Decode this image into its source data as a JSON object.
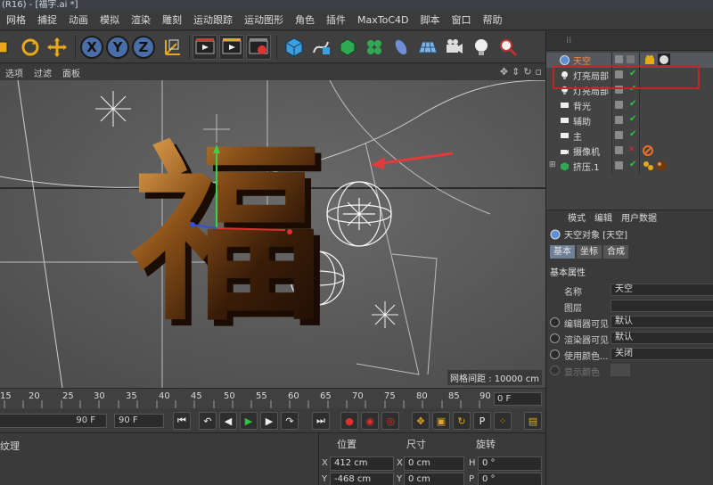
{
  "window": {
    "title": "(R16) - [福字.ai *]"
  },
  "menubar": [
    "网格",
    "捕捉",
    "动画",
    "模拟",
    "渲染",
    "雕刻",
    "运动跟踪",
    "运动图形",
    "角色",
    "插件",
    "MaxToC4D",
    "脚本",
    "窗口",
    "帮助"
  ],
  "toolbar": {
    "axis_x": "X",
    "axis_y": "Y",
    "axis_z": "Z"
  },
  "viewport": {
    "menus": [
      "选项",
      "过滤",
      "面板"
    ],
    "grid_spacing": "网格间距 : 10000 cm",
    "text_3d": "福"
  },
  "timeline": {
    "ticks": [
      "15",
      "20",
      "25",
      "30",
      "35",
      "40",
      "45",
      "50",
      "55",
      "60",
      "65",
      "70",
      "75",
      "80",
      "85",
      "90"
    ],
    "current_frame": "0 F"
  },
  "playback": {
    "end_frame_a": "90 F",
    "end_frame_b": "90 F"
  },
  "material_panel": {
    "label": "纹理"
  },
  "coords": {
    "headers": {
      "position": "位置",
      "size": "尺寸",
      "rotation": "旋转"
    },
    "rows": [
      {
        "axis": "X",
        "pos": "412 cm",
        "size_axis": "X",
        "size": "0 cm",
        "rot_axis": "H",
        "rot": "0 °"
      },
      {
        "axis": "Y",
        "pos": "-468 cm",
        "size_axis": "Y",
        "size": "0 cm",
        "rot_axis": "P",
        "rot": "0 °"
      }
    ]
  },
  "objects": {
    "items": [
      {
        "name": "天空",
        "selected": true
      },
      {
        "name": "灯亮局部"
      },
      {
        "name": "灯亮局部"
      },
      {
        "name": "背光"
      },
      {
        "name": "辅助"
      },
      {
        "name": "主"
      },
      {
        "name": "摄像机"
      },
      {
        "name": "挤压.1"
      }
    ]
  },
  "attributes": {
    "tabs": [
      "模式",
      "编辑",
      "用户数据"
    ],
    "title": "天空对象 [天空]",
    "subtabs": [
      "基本",
      "坐标",
      "合成"
    ],
    "section": "基本属性",
    "props": [
      {
        "label": "名称",
        "value": "天空"
      },
      {
        "label": "图层",
        "value": ""
      },
      {
        "label": "编辑器可见",
        "value": "默认"
      },
      {
        "label": "渲染器可见",
        "value": "默认"
      },
      {
        "label": "使用颜色...",
        "value": "关闭"
      },
      {
        "label": "显示颜色",
        "value": ""
      }
    ]
  },
  "colors": {
    "accent_blue": "#4a6fa8",
    "check_green": "#29c83a",
    "highlight_red": "#c02626",
    "arrow_red": "#e23b3b"
  }
}
